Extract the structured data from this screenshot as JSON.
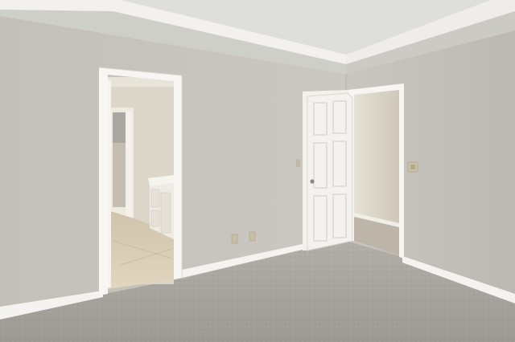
{
  "scene": {
    "kind": "photo",
    "room": "empty bedroom",
    "objects": [
      "textured-ceiling",
      "crown-molding",
      "tray-ceiling",
      "left-wall",
      "right-wall",
      "bathroom-doorway",
      "bathroom-vanity",
      "tile-floor",
      "open-door",
      "hallway-doorway",
      "carpet",
      "baseboards",
      "electrical-outlets",
      "light-switch"
    ]
  },
  "colors": {
    "ceiling": "#dcdcd8",
    "left_wall": "#c6c3bc",
    "right_wall": "#c1beb7",
    "trim": "#f6f5f1",
    "door": "#f3f2ee",
    "carpet": "#a8a49f",
    "bath_wall": "#d9d3c4",
    "tile": "#d8cbb2",
    "hall_wall": "#d8d2c4",
    "hall_carpet": "#b9b1a4"
  }
}
